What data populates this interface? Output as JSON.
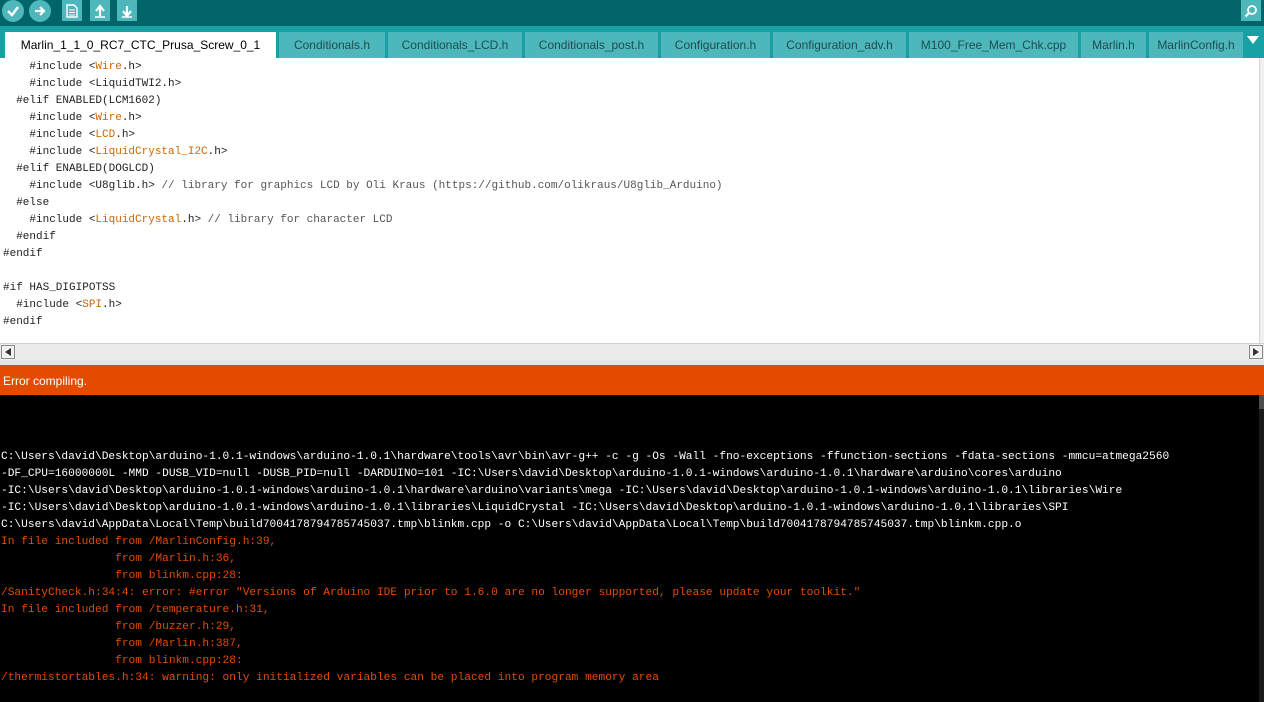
{
  "toolbar": {
    "buttons": [
      {
        "name": "verify-button",
        "icon": "checkmark-icon"
      },
      {
        "name": "upload-button",
        "icon": "arrow-right-icon"
      },
      {
        "name": "new-button",
        "icon": "document-icon"
      },
      {
        "name": "open-button",
        "icon": "arrow-up-icon"
      },
      {
        "name": "save-button",
        "icon": "arrow-down-icon"
      }
    ],
    "serial_monitor_icon": "magnifier-icon"
  },
  "tabs": [
    {
      "label": "Marlin_1_1_0_RC7_CTC_Prusa_Screw_0_1",
      "active": true
    },
    {
      "label": "Conditionals.h"
    },
    {
      "label": "Conditionals_LCD.h"
    },
    {
      "label": "Conditionals_post.h"
    },
    {
      "label": "Configuration.h"
    },
    {
      "label": "Configuration_adv.h"
    },
    {
      "label": "M100_Free_Mem_Chk.cpp"
    },
    {
      "label": "Marlin.h"
    },
    {
      "label": "MarlinConfig.h"
    }
  ],
  "code_lines": [
    {
      "pre": "    #include <",
      "kw": "Wire",
      "post": ".h>"
    },
    {
      "pre": "    #include <LiquidTWI2.h>"
    },
    {
      "pre": "  #elif ENABLED(LCM1602)"
    },
    {
      "pre": "    #include <",
      "kw": "Wire",
      "post": ".h>"
    },
    {
      "pre": "    #include <",
      "kw": "LCD",
      "post": ".h>"
    },
    {
      "pre": "    #include <",
      "kw": "LiquidCrystal_I2C",
      "post": ".h>"
    },
    {
      "pre": "  #elif ENABLED(DOGLCD)"
    },
    {
      "pre": "    #include <U8glib.h> ",
      "comment": "// library for graphics LCD by Oli Kraus (https://github.com/olikraus/U8glib_Arduino)"
    },
    {
      "pre": "  #else"
    },
    {
      "pre": "    #include <",
      "kw": "LiquidCrystal",
      "post": ".h> ",
      "comment": "// library for character LCD"
    },
    {
      "pre": "  #endif"
    },
    {
      "pre": "#endif"
    },
    {
      "pre": ""
    },
    {
      "pre": "#if HAS_DIGIPOTSS"
    },
    {
      "pre": "  #include <",
      "kw": "SPI",
      "post": ".h>"
    },
    {
      "pre": "#endif"
    }
  ],
  "status": {
    "message": "Error compiling."
  },
  "console": {
    "lines": [
      {
        "text": "C:\\Users\\david\\Desktop\\arduino-1.0.1-windows\\arduino-1.0.1\\hardware\\tools\\avr\\bin\\avr-g++ -c -g -Os -Wall -fno-exceptions -ffunction-sections -fdata-sections -mmcu=atmega2560",
        "kind": "info"
      },
      {
        "text": "-DF_CPU=16000000L -MMD -DUSB_VID=null -DUSB_PID=null -DARDUINO=101 -IC:\\Users\\david\\Desktop\\arduino-1.0.1-windows\\arduino-1.0.1\\hardware\\arduino\\cores\\arduino",
        "kind": "info"
      },
      {
        "text": "-IC:\\Users\\david\\Desktop\\arduino-1.0.1-windows\\arduino-1.0.1\\hardware\\arduino\\variants\\mega -IC:\\Users\\david\\Desktop\\arduino-1.0.1-windows\\arduino-1.0.1\\libraries\\Wire",
        "kind": "info"
      },
      {
        "text": "-IC:\\Users\\david\\Desktop\\arduino-1.0.1-windows\\arduino-1.0.1\\libraries\\LiquidCrystal -IC:\\Users\\david\\Desktop\\arduino-1.0.1-windows\\arduino-1.0.1\\libraries\\SPI",
        "kind": "info"
      },
      {
        "text": "C:\\Users\\david\\AppData\\Local\\Temp\\build7004178794785745037.tmp\\blinkm.cpp -o C:\\Users\\david\\AppData\\Local\\Temp\\build7004178794785745037.tmp\\blinkm.cpp.o",
        "kind": "info"
      },
      {
        "text": "In file included from /MarlinConfig.h:39,",
        "kind": "error"
      },
      {
        "text": "                 from /Marlin.h:36,",
        "kind": "error"
      },
      {
        "text": "                 from blinkm.cpp:28:",
        "kind": "error"
      },
      {
        "text": "/SanityCheck.h:34:4: error: #error \"Versions of Arduino IDE prior to 1.6.0 are no longer supported, please update your toolkit.\"",
        "kind": "error"
      },
      {
        "text": "In file included from /temperature.h:31,",
        "kind": "error"
      },
      {
        "text": "                 from /buzzer.h:29,",
        "kind": "error"
      },
      {
        "text": "                 from /Marlin.h:387,",
        "kind": "error"
      },
      {
        "text": "                 from blinkm.cpp:28:",
        "kind": "error"
      },
      {
        "text": "/thermistortables.h:34: warning: only initialized variables can be placed into program memory area",
        "kind": "error"
      }
    ]
  },
  "colors": {
    "toolbar_bg": "#006468",
    "tab_bar_bg": "#17a1a5",
    "tab_bg": "#4db7bb",
    "status_error_bg": "#e34c00",
    "console_info": "#ffffff",
    "console_error": "#e34c00",
    "keyword": "#cc6600"
  }
}
